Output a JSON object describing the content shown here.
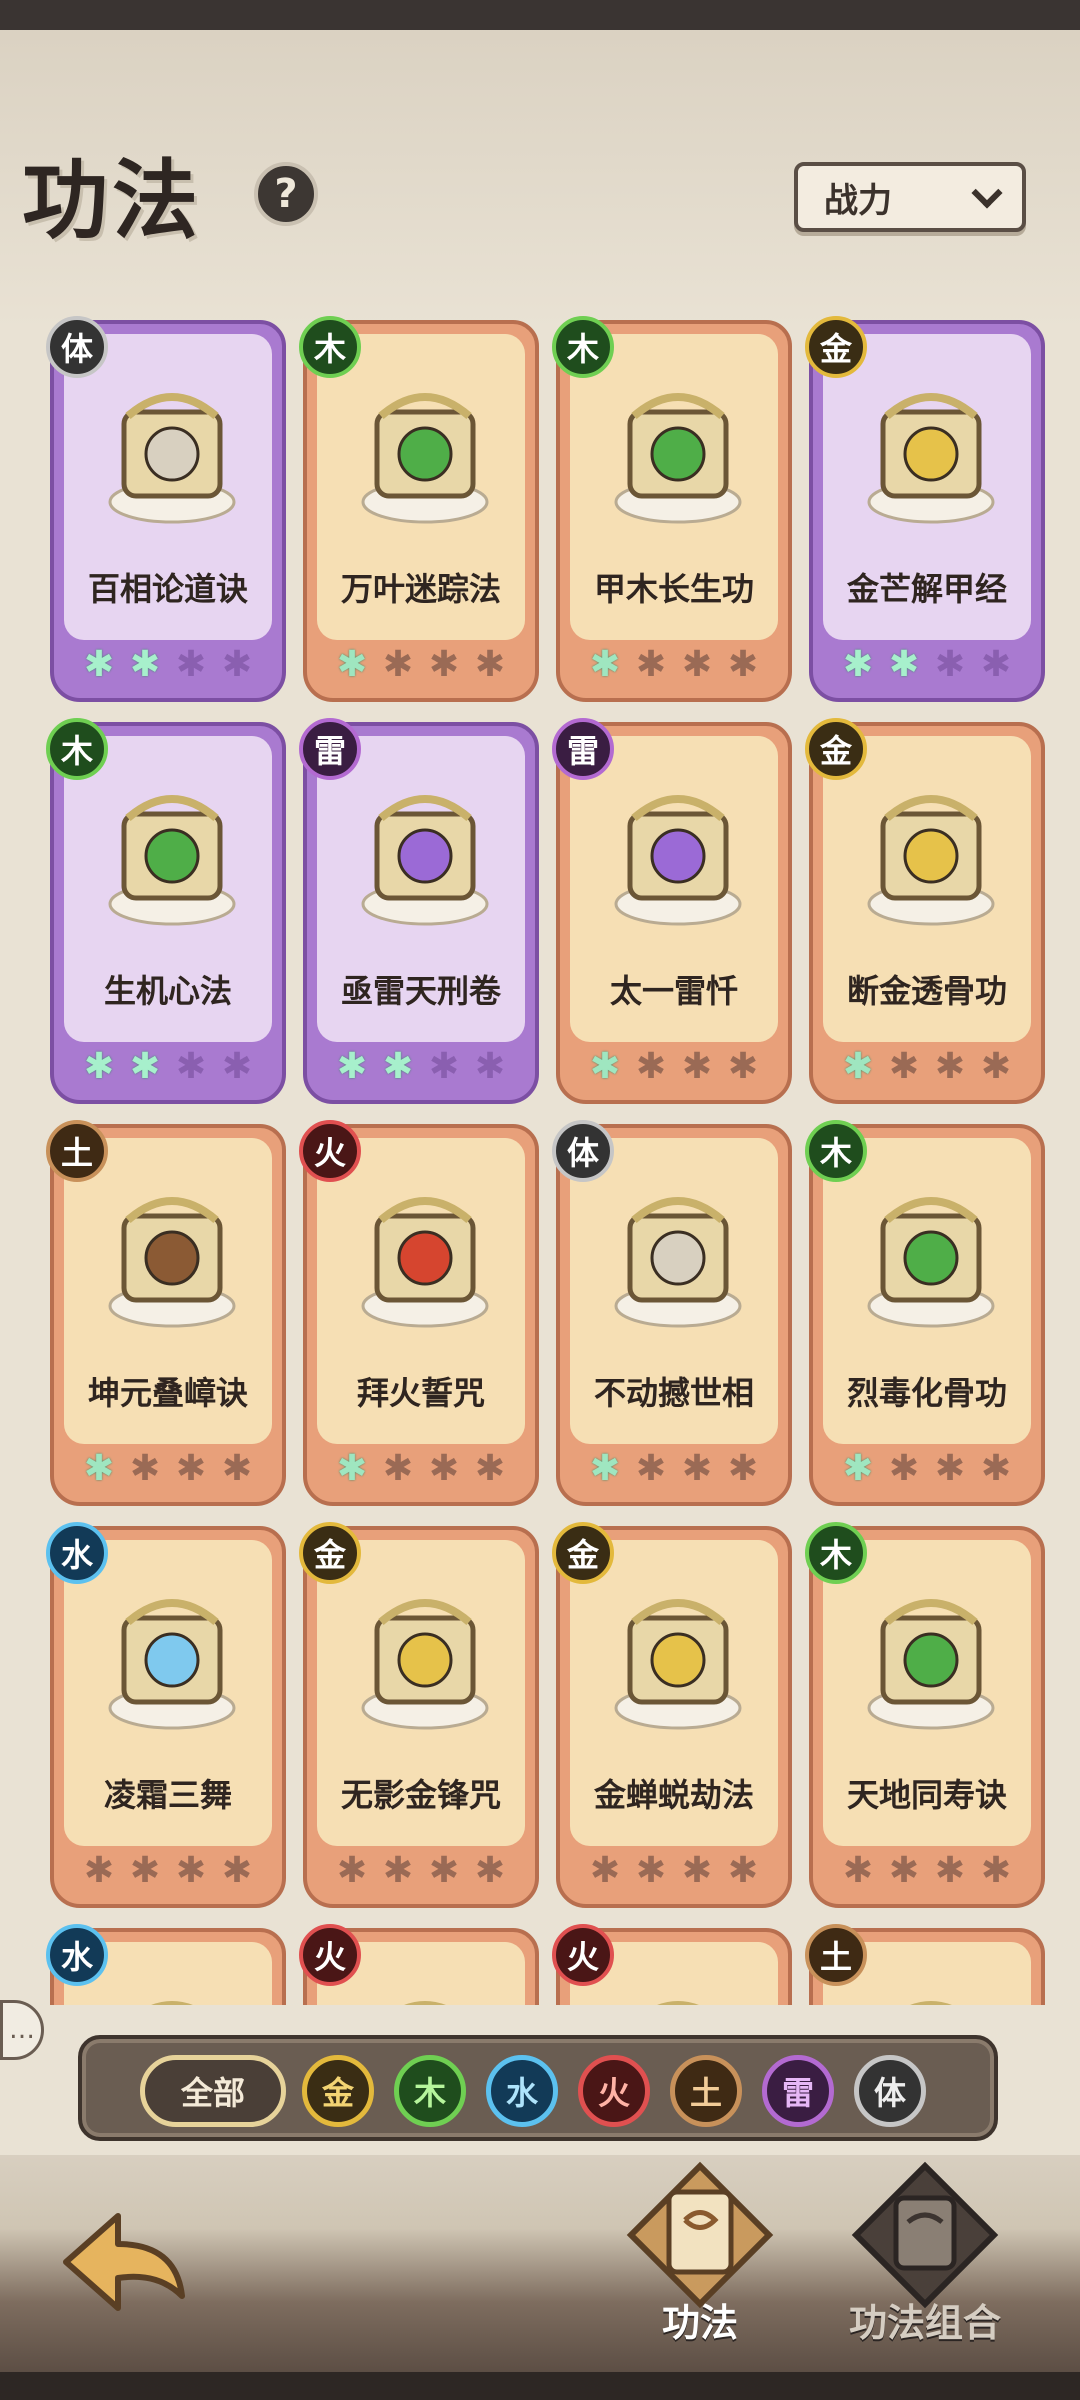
{
  "page": {
    "title": "功法",
    "help_icon": "question-icon"
  },
  "sort": {
    "label": "战力"
  },
  "cards": [
    {
      "name": "百相论道诀",
      "element": "体",
      "style": "purple",
      "stars": 2
    },
    {
      "name": "万叶迷踪法",
      "element": "木",
      "style": "orange",
      "stars": 1
    },
    {
      "name": "甲木长生功",
      "element": "木",
      "style": "orange",
      "stars": 1
    },
    {
      "name": "金芒解甲经",
      "element": "金",
      "style": "purple",
      "stars": 2
    },
    {
      "name": "生机心法",
      "element": "木",
      "style": "purple",
      "stars": 2
    },
    {
      "name": "亟雷天刑卷",
      "element": "雷",
      "style": "purple",
      "stars": 2
    },
    {
      "name": "太一雷忏",
      "element": "雷",
      "style": "orange",
      "stars": 1
    },
    {
      "name": "断金透骨功",
      "element": "金",
      "style": "orange",
      "stars": 1
    },
    {
      "name": "坤元叠嶂诀",
      "element": "土",
      "style": "orange",
      "stars": 1
    },
    {
      "name": "拜火誓咒",
      "element": "火",
      "style": "orange",
      "stars": 1
    },
    {
      "name": "不动撼世相",
      "element": "体",
      "style": "orange",
      "stars": 1
    },
    {
      "name": "烈毒化骨功",
      "element": "木",
      "style": "orange",
      "stars": 1
    },
    {
      "name": "凌霜三舞",
      "element": "水",
      "style": "orange",
      "stars": 0
    },
    {
      "name": "无影金锋咒",
      "element": "金",
      "style": "orange",
      "stars": 0
    },
    {
      "name": "金蝉蜕劫法",
      "element": "金",
      "style": "orange",
      "stars": 0
    },
    {
      "name": "天地同寿诀",
      "element": "木",
      "style": "orange",
      "stars": 0
    },
    {
      "name": "",
      "element": "水",
      "style": "orange",
      "stars": 0
    },
    {
      "name": "",
      "element": "火",
      "style": "orange",
      "stars": 0
    },
    {
      "name": "",
      "element": "火",
      "style": "orange",
      "stars": 0
    },
    {
      "name": "",
      "element": "土",
      "style": "orange",
      "stars": 0
    }
  ],
  "filters": {
    "all_label": "全部",
    "items": [
      "金",
      "木",
      "水",
      "火",
      "土",
      "雷",
      "体"
    ]
  },
  "nav": {
    "tab1_label": "功法",
    "tab2_label": "功法组合"
  },
  "colors": {
    "metal": "#e3b93c",
    "wood": "#6fcf52",
    "water": "#5cc1ef",
    "fire": "#e05050",
    "earth": "#c8915a",
    "thunder": "#b36ad1",
    "body": "#c6c6c6"
  }
}
